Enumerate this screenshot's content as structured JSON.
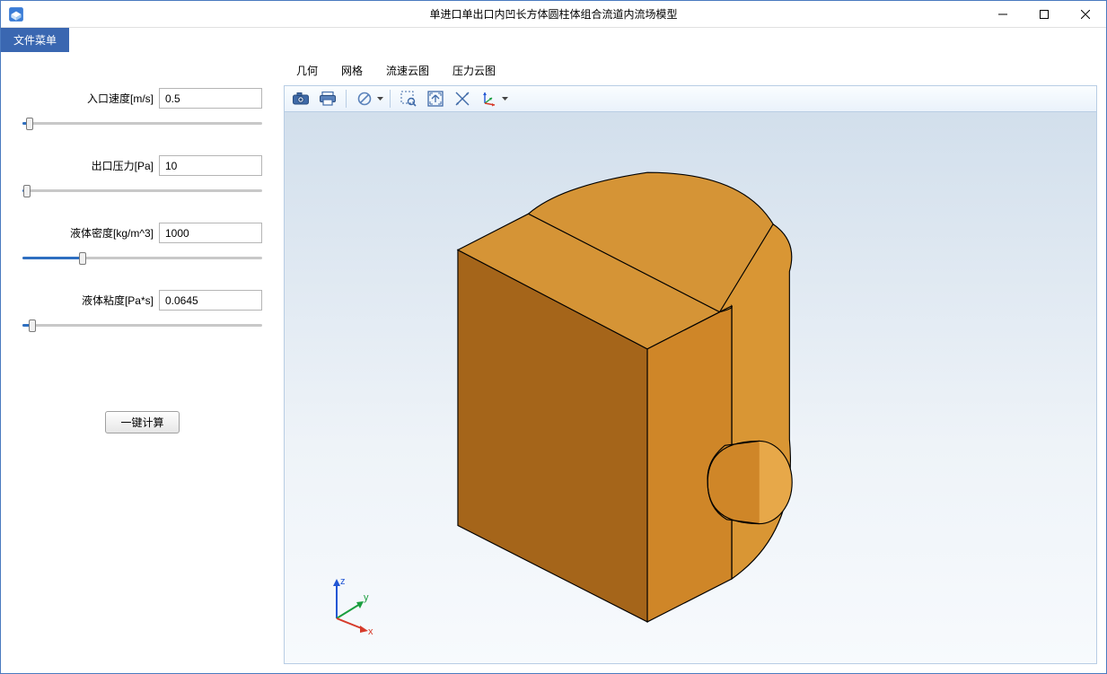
{
  "window": {
    "title": "单进口单出口内凹长方体圆柱体组合流道内流场模型"
  },
  "menubar": {
    "file_menu": "文件菜单"
  },
  "params": {
    "inlet_velocity": {
      "label": "入口速度[m/s]",
      "value": "0.5",
      "slider_pct": 3
    },
    "outlet_pressure": {
      "label": "出口压力[Pa]",
      "value": "10",
      "slider_pct": 2
    },
    "density": {
      "label": "液体密度[kg/m^3]",
      "value": "1000",
      "slider_pct": 25
    },
    "viscosity": {
      "label": "液体粘度[Pa*s]",
      "value": "0.0645",
      "slider_pct": 4
    }
  },
  "compute_button": "一键计算",
  "tabs": {
    "geometry": "几何",
    "mesh": "网格",
    "velocity_contour": "流速云图",
    "pressure_contour": "压力云图"
  },
  "triad": {
    "x": "x",
    "y": "y",
    "z": "z"
  },
  "colors": {
    "accent": "#3a67b1",
    "model_top": "#d08a2a",
    "model_left": "#a5651a",
    "model_right": "#c77f22"
  }
}
